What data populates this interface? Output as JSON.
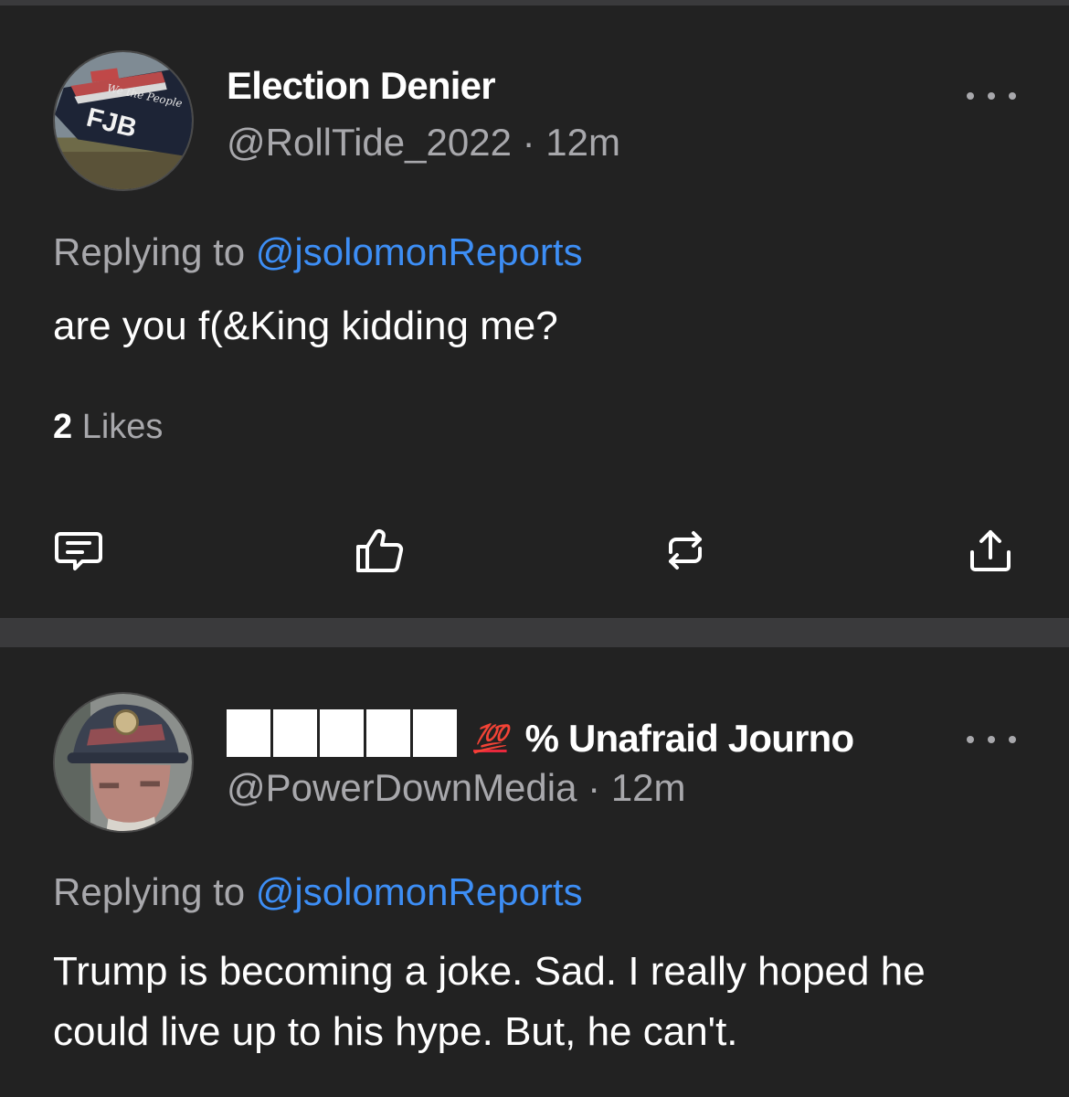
{
  "posts": [
    {
      "display_name": "Election Denier",
      "handle": "@RollTide_2022",
      "separator": "·",
      "time": "12m",
      "reply_prefix": "Replying to",
      "reply_to": "@jsolomonReports",
      "text": "are you f(&King kidding me?",
      "likes_count": "2",
      "likes_label": "Likes",
      "avatar": {
        "flag_text": "FJB",
        "script_text": "We the People"
      }
    },
    {
      "display_name_emoji": "💯",
      "display_name": "% Unafraid Journo",
      "handle": "@PowerDownMedia",
      "separator": "·",
      "time": "12m",
      "reply_prefix": "Replying to",
      "reply_to": "@jsolomonReports",
      "text": "Trump is becoming a joke. Sad. I really hoped he could live up to his hype. But, he can't."
    }
  ],
  "colors": {
    "background": "#222222",
    "separator": "#3a3a3c",
    "secondary_text": "#a8a8ac",
    "mention": "#3d8ef5"
  },
  "icons": [
    "comment-icon",
    "like-icon",
    "repost-icon",
    "share-icon",
    "more-icon"
  ]
}
